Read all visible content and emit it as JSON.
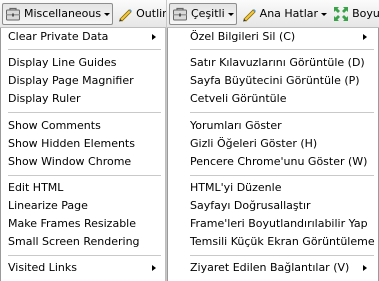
{
  "left": {
    "toolbar": {
      "misc_label": "Miscellaneous",
      "outline_label": "Outline"
    },
    "items": [
      "Clear Private Data",
      "Display Line Guides",
      "Display Page Magnifier",
      "Display Ruler",
      "Show Comments",
      "Show Hidden Elements",
      "Show Window Chrome",
      "Edit HTML",
      "Linearize Page",
      "Make Frames Resizable",
      "Small Screen Rendering",
      "Visited Links"
    ]
  },
  "right": {
    "toolbar": {
      "misc_label": "Çeşitli",
      "outline_label": "Ana Hatlar",
      "resize_label": "Boyutland"
    },
    "items": [
      "Özel Bilgileri Sil (C)",
      "Satır Kılavuzlarını Görüntüle (D)",
      "Sayfa Büyütecini Görüntüle (P)",
      "Cetveli Görüntüle",
      "Yorumları Göster",
      "Gizli Öğeleri Göster (H)",
      "Pencere Chrome'unu Göster (W)",
      "HTML'yi Düzenle",
      "Sayfayı Doğrusallaştır",
      "Frame'leri Boyutlandırılabilir Yap",
      "Temsili Küçük Ekran Görüntüleme",
      "Ziyaret Edilen Bağlantılar (V)"
    ]
  },
  "icons": [
    "toolbox-icon",
    "pencil-icon",
    "resize-icon"
  ]
}
